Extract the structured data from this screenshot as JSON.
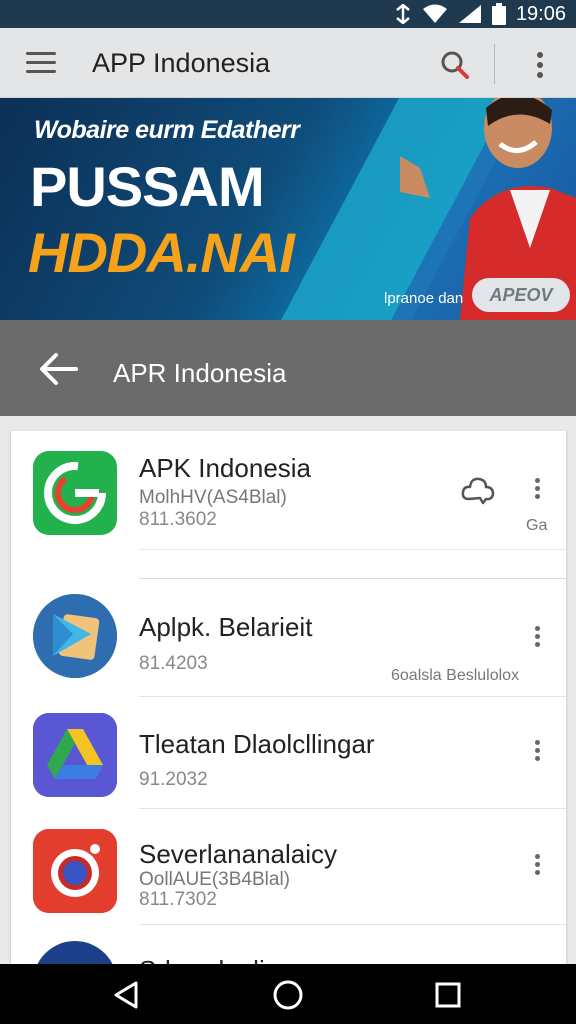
{
  "status": {
    "time": "19:06",
    "icons": [
      "data-icon",
      "wifi-icon",
      "signal-icon",
      "battery-icon"
    ]
  },
  "app_bar": {
    "title": "APP Indonesia",
    "icons": [
      "menu-icon",
      "search-icon",
      "more-vert-icon"
    ]
  },
  "banner": {
    "tagline": "Wobaire eurm Edatherr",
    "headline1": "PUSSAM",
    "headline2": "HDDA.NAI",
    "small_text": "lpranoe dan",
    "pill_label": "APEOV",
    "accent_color": "#f6a21b"
  },
  "subheader": {
    "title": "APR Indonesia"
  },
  "apps": [
    {
      "name": "APK Indonesia",
      "subtitle": "MolhHV(AS4Blal)",
      "number": "811.3602",
      "side_text": "Ga",
      "icon": "g-logo-icon",
      "has_action_icon": true
    },
    {
      "name": "Aplpk. Belarieit",
      "subtitle": "",
      "number": "81.4203",
      "side_text": "6oalsla Beslulolox",
      "icon": "play-icon"
    },
    {
      "name": "Tleatan Dlaolcllingar",
      "subtitle": "",
      "number": "91.2032",
      "side_text": "",
      "icon": "drive-icon"
    },
    {
      "name": "Severlananalaicy",
      "subtitle": "OollAUE(3B4Blal)",
      "number": "811.7302",
      "side_text": "",
      "icon": "camera-icon"
    },
    {
      "name": "Srlwaolaolin",
      "subtitle": "",
      "number": "",
      "side_text": "",
      "icon": "partial-app-icon"
    }
  ],
  "nav": {
    "icons": [
      "back-nav-icon",
      "home-nav-icon",
      "recents-nav-icon"
    ]
  }
}
